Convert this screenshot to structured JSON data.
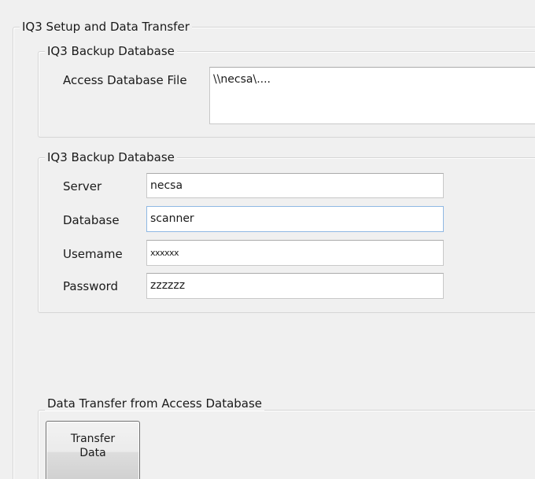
{
  "outer_group": {
    "title": "IQ3 Setup and Data Transfer"
  },
  "access_group": {
    "title": "IQ3 Backup Database",
    "file_label": "Access Database File",
    "file_value": "\\\\necsa\\...."
  },
  "sql_group": {
    "title": "IQ3 Backup Database",
    "server_label": "Server",
    "server_value": "necsa",
    "database_label": "Database",
    "database_value": "scanner",
    "username_label": "Usemame",
    "username_value": "xxxxxx",
    "password_label": "Password",
    "password_value": "zzzzzz"
  },
  "transfer_group": {
    "title": "Data Transfer from Access Database",
    "button_line1": "Transfer",
    "button_line2": "Data"
  }
}
